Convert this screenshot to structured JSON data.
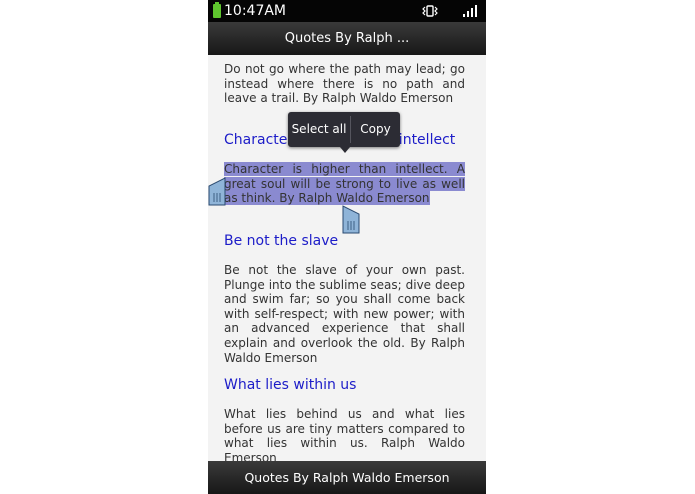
{
  "status_bar": {
    "time": "10:47AM",
    "battery_color": "#5fc62e",
    "icons": [
      "battery-icon",
      "vibrate-icon",
      "signal-icon"
    ]
  },
  "header": {
    "title": "Quotes By Ralph ..."
  },
  "quotes": [
    {
      "text": "Do not go where the path may lead; go instead where there is no path and leave a trail. By Ralph Waldo Emerson"
    },
    {
      "title": "Character is higher than intellect",
      "text": "Character is higher than intellect. A great soul will be strong to live as well as think. By Ralph Waldo Emerson"
    },
    {
      "title": "Be not the slave",
      "text": "Be not the slave of your own past. Plunge into the sublime seas; dive deep and swim far; so you shall come back with self-respect; with new power; with an advanced experience that shall explain and overlook the old. By Ralph Waldo Emerson"
    },
    {
      "title": "What lies within us",
      "text": "What lies behind us and what lies before us are tiny matters compared to what lies within us. Ralph Waldo Emerson"
    }
  ],
  "selection_menu": {
    "select_all": "Select all",
    "copy": "Copy"
  },
  "footer": {
    "title": "Quotes By Ralph Waldo Emerson"
  },
  "colors": {
    "heading": "#1c1cc8",
    "selection": "#8a8ad0",
    "bars": "#1a1a1a"
  }
}
